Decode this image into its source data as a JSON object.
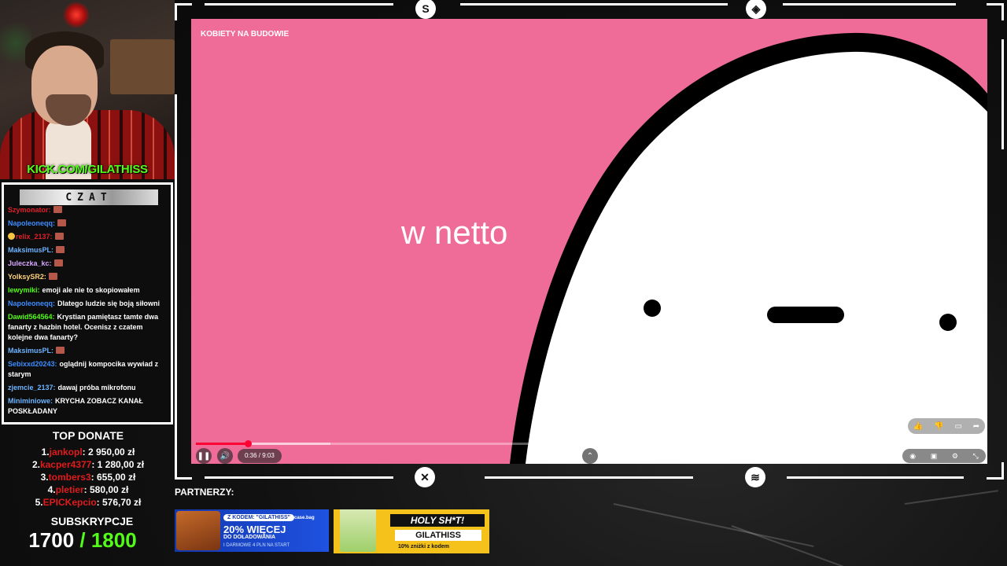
{
  "webcam": {
    "channel_url": "KICK.COM/GILATHISS"
  },
  "chat": {
    "header": "CZAT",
    "messages": [
      {
        "user": "Szymonator:",
        "user_color": "#e0202a",
        "text": "",
        "emote": true
      },
      {
        "user": "Napoleoneqq:",
        "user_color": "#3b8cff",
        "text": "",
        "emote": true
      },
      {
        "user": "relix_2137:",
        "user_color": "#e0202a",
        "text": "",
        "emote": true,
        "face": true
      },
      {
        "user": "MaksimusPL:",
        "user_color": "#6cb4ff",
        "text": "",
        "emote": true
      },
      {
        "user": "Juleczka_kc:",
        "user_color": "#d7a6ff",
        "text": "",
        "emote": true
      },
      {
        "user": "YolksySR2:",
        "user_color": "#ffd27a",
        "text": "",
        "emote": true
      },
      {
        "user": "lewymiki:",
        "user_color": "#53fc18",
        "text": "emoji ale nie to skopiowałem",
        "emote": false
      },
      {
        "user": "Napoleoneqq:",
        "user_color": "#3b8cff",
        "text": "Dlatego ludzie się boją siłowni",
        "emote": false
      },
      {
        "user": "Dawid564564:",
        "user_color": "#53fc18",
        "text": "Krystian pamiętasz tamte dwa fanarty z hazbin hotel. Ocenisz z czatem kolejne dwa fanarty?",
        "emote": false
      },
      {
        "user": "MaksimusPL:",
        "user_color": "#6cb4ff",
        "text": "",
        "emote": true
      },
      {
        "user": "Sebixxd20243:",
        "user_color": "#3b8cff",
        "text": "oglądnij kompocika wywiad z starym",
        "emote": false
      },
      {
        "user": "zjemcie_2137:",
        "user_color": "#6cb4ff",
        "text": "dawaj próba mikrofonu",
        "emote": false
      },
      {
        "user": "Miniminiowe:",
        "user_color": "#6cb4ff",
        "text": "KRYCHA ZOBACZ KANAŁ POSKŁADANY",
        "emote": false
      }
    ]
  },
  "donations": {
    "title": "TOP DONATE",
    "entries": [
      {
        "rank": "1.",
        "name": "jankopl",
        "amount": ": 2 950,00 zł"
      },
      {
        "rank": "2.",
        "name": "kacper4377",
        "amount": ": 1 280,00 zł"
      },
      {
        "rank": "3.",
        "name": "tombers3",
        "amount": ": 655,00 zł"
      },
      {
        "rank": "4.",
        "name": "pletier",
        "amount": ": 580,00 zł"
      },
      {
        "rank": "5.",
        "name": "EPICKepcio",
        "amount": ": 576,70 zł"
      }
    ]
  },
  "subs": {
    "title": "SUBSKRYPCJE",
    "current": "1700",
    "goal": " / 1800"
  },
  "player": {
    "video_title": "KOBIETY NA BUDOWIE",
    "caption": "w netto",
    "time": "0:36 / 9:03",
    "progress": 0.066,
    "buffered": 0.17,
    "colors": {
      "background": "#f06c98",
      "progress": "#ff0033"
    },
    "icons": [
      "pause-icon",
      "volume-icon",
      "chevron-up-icon",
      "autoplay-toggle-icon",
      "subtitles-icon",
      "settings-icon",
      "fullscreen-icon",
      "like-icon",
      "dislike-icon",
      "comment-icon",
      "share-icon"
    ]
  },
  "partners": {
    "label": "PARTNERZY:",
    "banner1": {
      "code": "Z KODEM: \"GILATHISS\"",
      "brand": "case.bag",
      "big": "20% WIĘCEJ",
      "line2": "DO DOŁADOWANIA",
      "line3": "I DARMOWE 4 PLN NA START"
    },
    "banner2": {
      "title": "HOLY SH*T!",
      "code": "GILATHISS",
      "small": "10% zniżki z kodem"
    }
  }
}
